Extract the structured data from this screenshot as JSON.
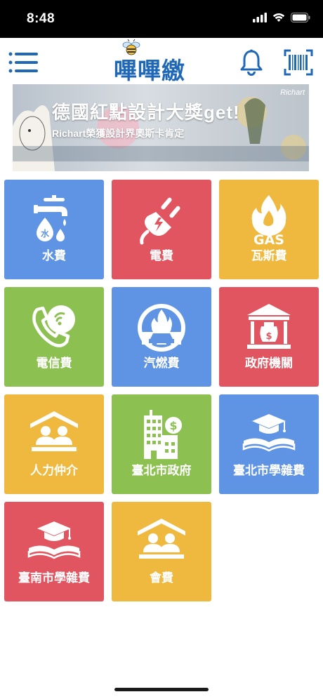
{
  "status_bar": {
    "time": "8:48"
  },
  "nav": {
    "logo_text": "嗶嗶繳"
  },
  "banner": {
    "title": "德國紅點設計大獎get!",
    "subtitle": "Richart榮獲設計界奧斯卡肯定",
    "brand": "Richart"
  },
  "tiles": [
    {
      "label": "水費",
      "color": "#5f93e3",
      "icon": "water-tap-icon"
    },
    {
      "label": "電費",
      "color": "#e0555f",
      "icon": "plug-icon"
    },
    {
      "label": "瓦斯費",
      "color": "#efb93f",
      "icon": "gas-flame-icon"
    },
    {
      "label": "電信費",
      "color": "#8cc152",
      "icon": "phone-icon"
    },
    {
      "label": "汽燃費",
      "color": "#5f93e3",
      "icon": "car-fuel-icon"
    },
    {
      "label": "政府機關",
      "color": "#e0555f",
      "icon": "government-building-icon"
    },
    {
      "label": "人力仲介",
      "color": "#efb93f",
      "icon": "people-house-icon"
    },
    {
      "label": "臺北市政府",
      "color": "#8cc152",
      "icon": "city-hall-icon"
    },
    {
      "label": "臺北市學雜費",
      "color": "#5f93e3",
      "icon": "graduation-book-icon"
    },
    {
      "label": "臺南市學雜費",
      "color": "#e0555f",
      "icon": "graduation-book-icon"
    },
    {
      "label": "會費",
      "color": "#efb93f",
      "icon": "people-house-icon"
    }
  ]
}
